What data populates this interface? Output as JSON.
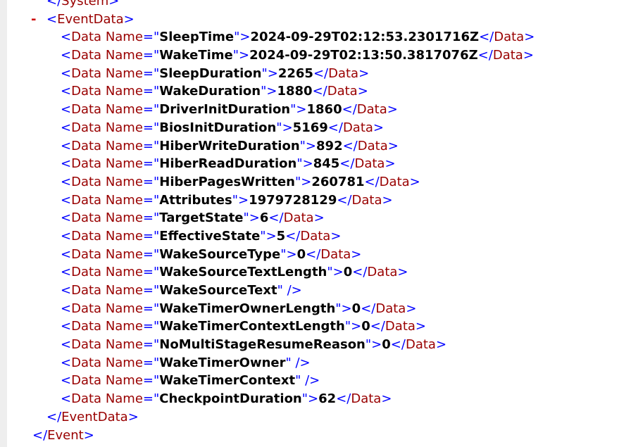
{
  "system_close": "System",
  "event_data_name": "EventData",
  "event_name": "Event",
  "data_tag": "Data",
  "attr_name": "Name",
  "collapse_symbol": "-",
  "items": [
    {
      "name": "SleepTime",
      "value": "2024-09-29T02:12:53.2301716Z"
    },
    {
      "name": "WakeTime",
      "value": "2024-09-29T02:13:50.3817076Z"
    },
    {
      "name": "SleepDuration",
      "value": "2265"
    },
    {
      "name": "WakeDuration",
      "value": "1880"
    },
    {
      "name": "DriverInitDuration",
      "value": "1860"
    },
    {
      "name": "BiosInitDuration",
      "value": "5169"
    },
    {
      "name": "HiberWriteDuration",
      "value": "892"
    },
    {
      "name": "HiberReadDuration",
      "value": "845"
    },
    {
      "name": "HiberPagesWritten",
      "value": "260781"
    },
    {
      "name": "Attributes",
      "value": "1979728129"
    },
    {
      "name": "TargetState",
      "value": "6"
    },
    {
      "name": "EffectiveState",
      "value": "5"
    },
    {
      "name": "WakeSourceType",
      "value": "0"
    },
    {
      "name": "WakeSourceTextLength",
      "value": "0"
    },
    {
      "name": "WakeSourceText",
      "value": null
    },
    {
      "name": "WakeTimerOwnerLength",
      "value": "0"
    },
    {
      "name": "WakeTimerContextLength",
      "value": "0"
    },
    {
      "name": "NoMultiStageResumeReason",
      "value": "0"
    },
    {
      "name": "WakeTimerOwner",
      "value": null
    },
    {
      "name": "WakeTimerContext",
      "value": null
    },
    {
      "name": "CheckpointDuration",
      "value": "62"
    }
  ]
}
